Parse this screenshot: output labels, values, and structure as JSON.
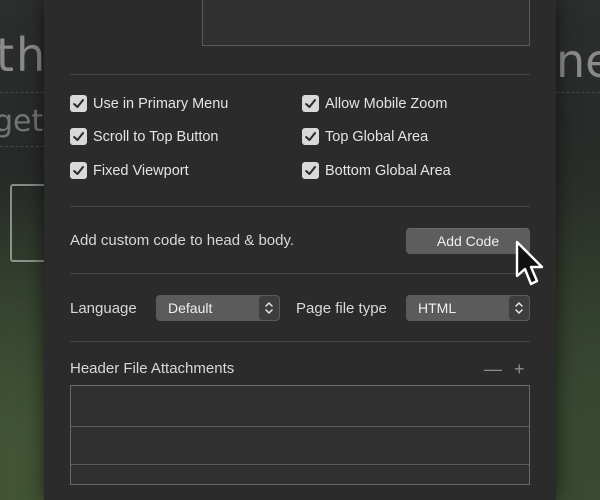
{
  "background": {
    "text_left_1": "th",
    "text_left_2": "get",
    "text_right_1": "ne"
  },
  "options": {
    "checkboxes": [
      {
        "label": "Use in Primary Menu",
        "checked": true
      },
      {
        "label": "Allow Mobile Zoom",
        "checked": true
      },
      {
        "label": "Scroll to Top Button",
        "checked": true
      },
      {
        "label": "Top Global Area",
        "checked": true
      },
      {
        "label": "Fixed Viewport",
        "checked": true
      },
      {
        "label": "Bottom Global Area",
        "checked": true
      }
    ]
  },
  "custom_code": {
    "description": "Add custom code to head & body.",
    "button_label": "Add Code"
  },
  "settings": {
    "language_label": "Language",
    "language_value": "Default",
    "file_type_label": "Page file type",
    "file_type_value": "HTML"
  },
  "attachments": {
    "title": "Header File Attachments",
    "remove_symbol": "—",
    "add_symbol": "+"
  },
  "colors": {
    "panel_bg": "#2b2b2b",
    "control_bg": "#5b5b5b",
    "checkbox_bg": "#d9d9d9"
  },
  "icons": [
    "checkmark-icon",
    "stepper-icon",
    "minus-icon",
    "plus-icon",
    "pointer-cursor-icon"
  ]
}
